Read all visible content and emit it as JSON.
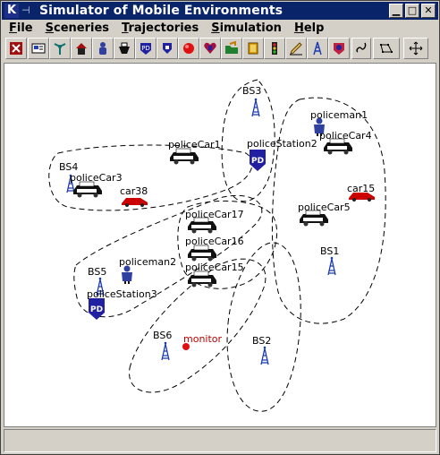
{
  "window": {
    "title": "Simulator of Mobile Environments",
    "logo": "K",
    "controls": {
      "minimize": "▁",
      "maximize": "□",
      "close": "✕"
    }
  },
  "menu": [
    {
      "label": "File",
      "u": "F",
      "rest": "ile"
    },
    {
      "label": "Sceneries",
      "u": "S",
      "rest": "ceneries"
    },
    {
      "label": "Trajectories",
      "u": "T",
      "rest": "rajectories"
    },
    {
      "label": "Simulation",
      "u": "S",
      "rest": "imulation"
    },
    {
      "label": "Help",
      "u": "H",
      "rest": "elp"
    }
  ],
  "toolbar": {
    "icons": [
      "exit-icon",
      "card-icon",
      "antenna-icon",
      "house-icon",
      "person-icon",
      "police-car-icon",
      "police-station-icon",
      "car-icon",
      "red-dot-icon",
      "mobile-heart-icon",
      "folder-icon",
      "cards-icon",
      "traffic-light-icon",
      "write-icon",
      "tower-icon",
      "badge-icon",
      "link-icon",
      "path-icon",
      "move-icon"
    ]
  },
  "map": {
    "labels": [
      {
        "text": "BS3",
        "name": "label-bs3"
      },
      {
        "text": "policeman1",
        "name": "label-policeman1"
      },
      {
        "text": "policeCar4",
        "name": "label-policecar4"
      },
      {
        "text": "policeCar1",
        "name": "label-policecar1"
      },
      {
        "text": "policeStation2",
        "name": "label-policestation2"
      },
      {
        "text": "BS4",
        "name": "label-bs4"
      },
      {
        "text": "policeCar3",
        "name": "label-policecar3"
      },
      {
        "text": "car38",
        "name": "label-car38"
      },
      {
        "text": "car15",
        "name": "label-car15"
      },
      {
        "text": "policeCar5",
        "name": "label-policecar5"
      },
      {
        "text": "policeCar17",
        "name": "label-policecar17"
      },
      {
        "text": "policeCar16",
        "name": "label-policecar16"
      },
      {
        "text": "BS1",
        "name": "label-bs1"
      },
      {
        "text": "policeman2",
        "name": "label-policeman2"
      },
      {
        "text": "policeCar15",
        "name": "label-policecar15"
      },
      {
        "text": "BS5",
        "name": "label-bs5"
      },
      {
        "text": "policeStation3",
        "name": "label-policestation3"
      },
      {
        "text": "BS6",
        "name": "label-bs6"
      },
      {
        "text": "monitor",
        "name": "label-monitor"
      },
      {
        "text": "BS2",
        "name": "label-bs2"
      }
    ],
    "colors": {
      "monitor": "#c00000",
      "station": "#2020a0",
      "car_red": "#cc0000",
      "policeman": "#3040a0"
    }
  }
}
